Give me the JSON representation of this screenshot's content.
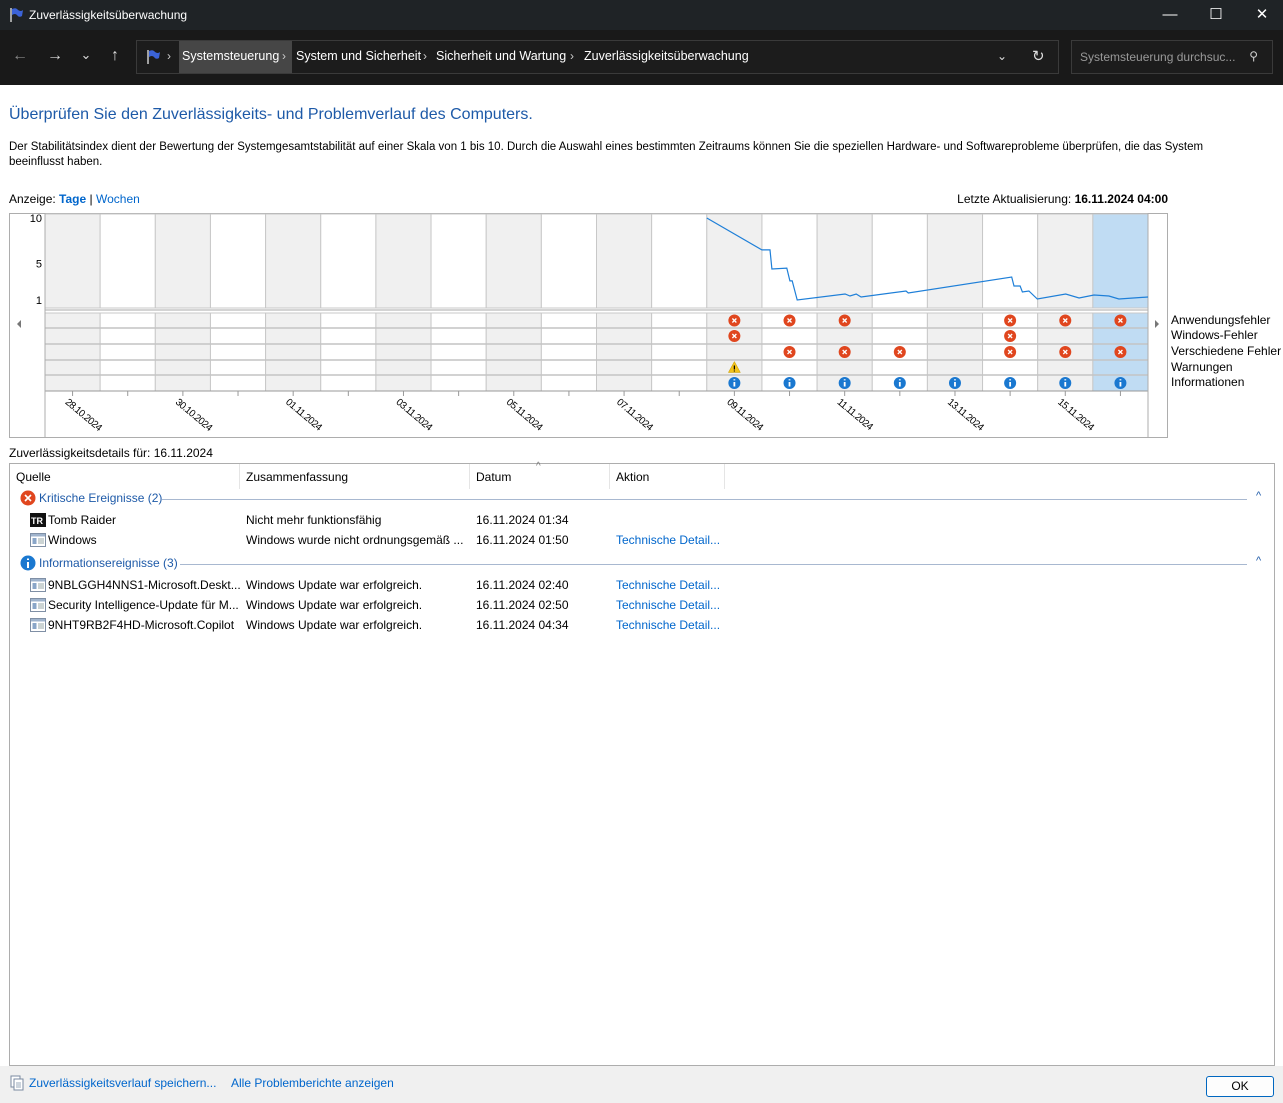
{
  "window": {
    "title": "Zuverlässigkeitsüberwachung",
    "minimize": "—",
    "maximize": "☐",
    "close": "✕"
  },
  "nav": {
    "back": "←",
    "forward": "→",
    "recent": "⌄",
    "up": "↑",
    "breadcrumb": [
      "Systemsteuerung",
      "System und Sicherheit",
      "Sicherheit und Wartung",
      "Zuverlässigkeitsüberwachung"
    ],
    "search_placeholder": "Systemsteuerung durchsuc..."
  },
  "page": {
    "heading": "Überprüfen Sie den Zuverlässigkeits- und Problemverlauf des Computers.",
    "description": "Der Stabilitätsindex dient der Bewertung der Systemgesamtstabilität auf einer Skala von 1 bis 10. Durch die Auswahl eines bestimmten Zeitraums können Sie die speziellen Hardware- und Softwareprobleme überprüfen, die das System beeinflusst haben.",
    "view_label": "Anzeige:",
    "view_days": "Tage",
    "view_sep": "|",
    "view_weeks": "Wochen",
    "last_update_label": "Letzte Aktualisierung:",
    "last_update_value": "16.11.2024 04:00",
    "details_for": "Zuverlässigkeitsdetails für: 16.11.2024"
  },
  "chart_data": {
    "type": "line",
    "yticks": [
      "10",
      "5",
      "1"
    ],
    "ylim": [
      1,
      10
    ],
    "days": [
      "28.10.2024",
      "29.10.2024",
      "30.10.2024",
      "31.10.2024",
      "01.11.2024",
      "02.11.2024",
      "03.11.2024",
      "04.11.2024",
      "05.11.2024",
      "06.11.2024",
      "07.11.2024",
      "08.11.2024",
      "09.11.2024",
      "10.11.2024",
      "11.11.2024",
      "12.11.2024",
      "13.11.2024",
      "14.11.2024",
      "15.11.2024",
      "16.11.2024"
    ],
    "selected_day": "16.11.2024",
    "stability": [
      [
        "2024-11-09T00:00",
        10
      ],
      [
        "2024-11-10T00:00",
        6.5
      ],
      [
        "2024-11-10T03:30",
        6.5
      ],
      [
        "2024-11-10T04:20",
        4.4
      ],
      [
        "2024-11-10T10:50",
        4.5
      ],
      [
        "2024-11-10T12:10",
        3.1
      ],
      [
        "2024-11-10T13:10",
        3.1
      ],
      [
        "2024-11-10T15:20",
        1.0
      ],
      [
        "2024-11-11T12:10",
        1.66
      ],
      [
        "2024-11-11T14:20",
        1.44
      ],
      [
        "2024-11-11T17:00",
        1.66
      ],
      [
        "2024-11-11T19:10",
        1.33
      ],
      [
        "2024-11-12T14:40",
        1.99
      ],
      [
        "2024-11-12T15:40",
        1.77
      ],
      [
        "2024-11-14T12:40",
        3.52
      ],
      [
        "2024-11-14T13:40",
        2.54
      ],
      [
        "2024-11-14T16:20",
        2.54
      ],
      [
        "2024-11-14T17:20",
        1.88
      ],
      [
        "2024-11-14T20:10",
        1.99
      ],
      [
        "2024-11-14T23:50",
        1.11
      ],
      [
        "2024-11-15T12:10",
        1.66
      ],
      [
        "2024-11-15T18:00",
        1.22
      ],
      [
        "2024-11-16T00:30",
        1.55
      ],
      [
        "2024-11-16T07:00",
        1.44
      ],
      [
        "2024-11-16T11:20",
        1.11
      ],
      [
        "2024-11-17T00:00",
        1.33
      ]
    ],
    "event_rows": [
      {
        "name": "Anwendungsfehler",
        "kind": "error",
        "days": [
          "09.11.2024",
          "10.11.2024",
          "11.11.2024",
          "14.11.2024",
          "15.11.2024",
          "16.11.2024"
        ]
      },
      {
        "name": "Windows-Fehler",
        "kind": "error",
        "days": [
          "09.11.2024",
          "14.11.2024"
        ]
      },
      {
        "name": "Verschiedene Fehler",
        "kind": "error",
        "days": [
          "10.11.2024",
          "11.11.2024",
          "12.11.2024",
          "14.11.2024",
          "15.11.2024",
          "16.11.2024"
        ]
      },
      {
        "name": "Warnungen",
        "kind": "warning",
        "days": [
          "09.11.2024"
        ]
      },
      {
        "name": "Informationen",
        "kind": "info",
        "days": [
          "09.11.2024",
          "10.11.2024",
          "11.11.2024",
          "12.11.2024",
          "13.11.2024",
          "14.11.2024",
          "15.11.2024",
          "16.11.2024"
        ]
      }
    ],
    "colors": {
      "line": "#1e7fd8",
      "error": "#e0461e",
      "warning": "#f2c31a",
      "info": "#1a78d0",
      "selected": "#c0dcf3",
      "alt": "#f0f0f0"
    }
  },
  "list": {
    "columns": [
      "Quelle",
      "Zusammenfassung",
      "Datum",
      "Aktion"
    ],
    "groups": [
      {
        "title": "Kritische Ereignisse (2)",
        "icon": "error",
        "rows": [
          {
            "source": "Tomb Raider",
            "icon": "tr-app",
            "summary": "Nicht mehr funktionsfähig",
            "date": "16.11.2024 01:34",
            "action": ""
          },
          {
            "source": "Windows",
            "icon": "window",
            "summary": "Windows wurde nicht ordnungsgemäß ...",
            "date": "16.11.2024 01:50",
            "action": "Technische Detail..."
          }
        ]
      },
      {
        "title": "Informationsereignisse (3)",
        "icon": "info",
        "rows": [
          {
            "source": "9NBLGGH4NNS1-Microsoft.Deskt...",
            "icon": "window",
            "summary": "Windows Update war erfolgreich.",
            "date": "16.11.2024 02:40",
            "action": "Technische Detail..."
          },
          {
            "source": "Security Intelligence-Update für M...",
            "icon": "window",
            "summary": "Windows Update war erfolgreich.",
            "date": "16.11.2024 02:50",
            "action": "Technische Detail..."
          },
          {
            "source": "9NHT9RB2F4HD-Microsoft.Copilot",
            "icon": "window",
            "summary": "Windows Update war erfolgreich.",
            "date": "16.11.2024 04:34",
            "action": "Technische Detail..."
          }
        ]
      }
    ]
  },
  "footer": {
    "save": "Zuverlässigkeitsverlauf speichern...",
    "all_reports": "Alle Problemberichte anzeigen",
    "ok": "OK"
  }
}
